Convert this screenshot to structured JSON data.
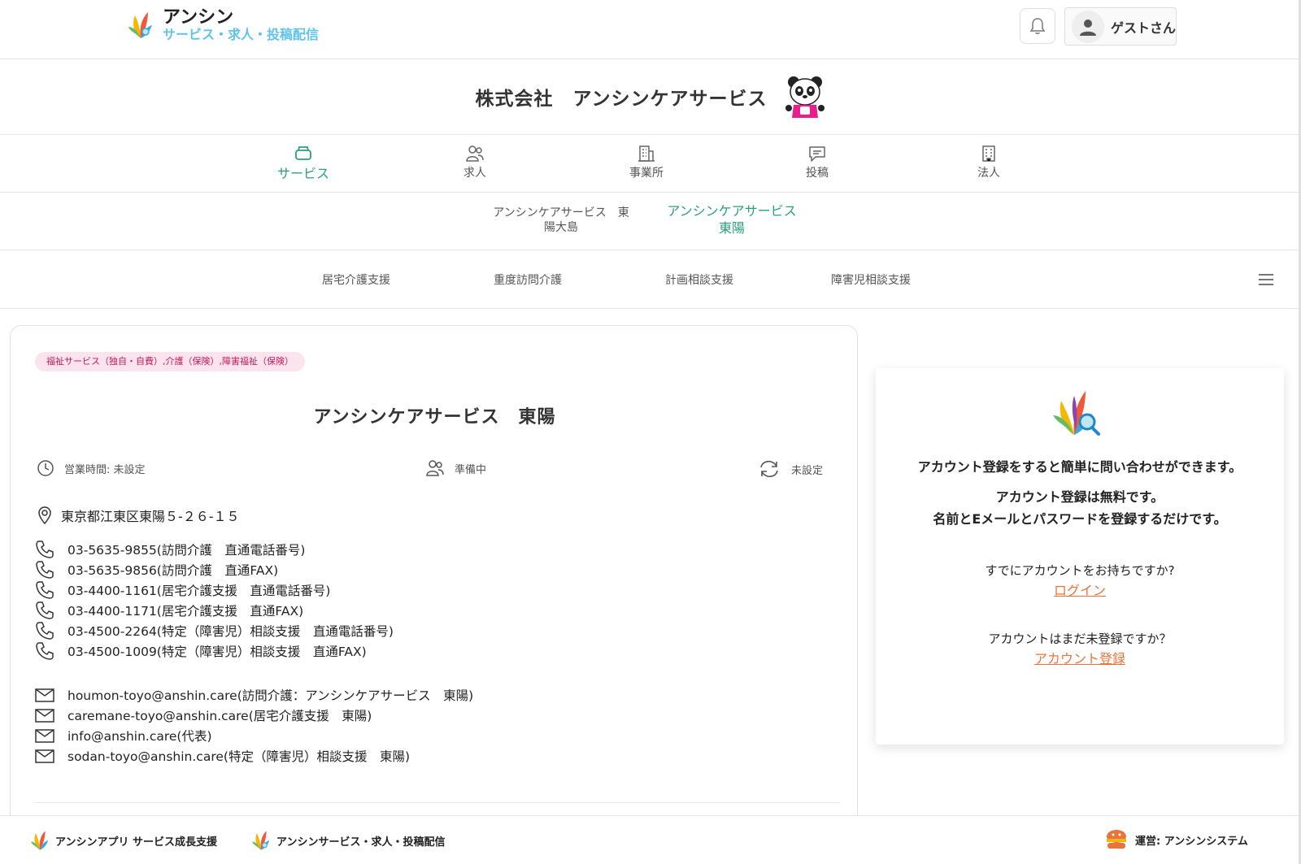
{
  "header": {
    "logo_title": "アンシン",
    "logo_subtitle": "サービス・求人・投稿配信",
    "user_name": "ゲストさん"
  },
  "company": {
    "name": "株式会社　アンシンケアサービス"
  },
  "main_tabs": [
    {
      "label": "サービス",
      "icon": "service-icon",
      "active": true
    },
    {
      "label": "求人",
      "icon": "people-icon"
    },
    {
      "label": "事業所",
      "icon": "building-icon"
    },
    {
      "label": "投稿",
      "icon": "message-icon"
    },
    {
      "label": "法人",
      "icon": "corporation-icon"
    }
  ],
  "office_tabs": [
    {
      "line1": "アンシンケアサービス　東",
      "line2": "陽大島"
    },
    {
      "line1": "アンシンケアサービス",
      "line2": "東陽",
      "active": true
    }
  ],
  "service_tabs": [
    "居宅介護支援",
    "重度訪問介護",
    "計画相談支援",
    "障害児相談支援"
  ],
  "card": {
    "tag": "福祉サービス（独自・自費）,介護（保険）,障害福祉（保険）",
    "facility_name": "アンシンケアサービス　東陽",
    "hours": "営業時間: 未設定",
    "status": "準備中",
    "update": "未設定",
    "address": "東京都江東区東陽５-２６-１５",
    "phones": [
      "03-5635-9855(訪問介護　直通電話番号)",
      "03-5635-9856(訪問介護　直通FAX)",
      "03-4400-1161(居宅介護支援　直通電話番号)",
      "03-4400-1171(居宅介護支援　直通FAX)",
      "03-4500-2264(特定（障害児）相談支援　直通電話番号)",
      "03-4500-1009(特定（障害児）相談支援　直通FAX)"
    ],
    "emails": [
      "houmon-toyo@anshin.care(訪問介護：アンシンケアサービス　東陽)",
      "caremane-toyo@anshin.care(居宅介護支援　東陽)",
      "info@anshin.care(代表)",
      "sodan-toyo@anshin.care(特定（障害児）相談支援　東陽)"
    ]
  },
  "side": {
    "line1": "アカウント登録をすると簡単に問い合わせができます。",
    "line2": "アカウント登録は無料です。",
    "line3": "名前とEメールとパスワードを登録するだけです。",
    "has_account": "すでにアカウントをお持ちですか?",
    "login": "ログイン",
    "no_account": "アカウントはまだ未登録ですか？",
    "register": "アカウント登録"
  },
  "footer": {
    "app_label": "アンシンアプリ サービス成長支援",
    "service_label": "アンシンサービス・求人・投稿配信",
    "operator_label": "運営: アンシンシステム"
  },
  "colors": {
    "accent": "#2aa07a",
    "link": "#e8743b",
    "logo_sub": "#5fc3ea",
    "tag_bg": "#fce4ef",
    "tag_text": "#c2185b"
  }
}
